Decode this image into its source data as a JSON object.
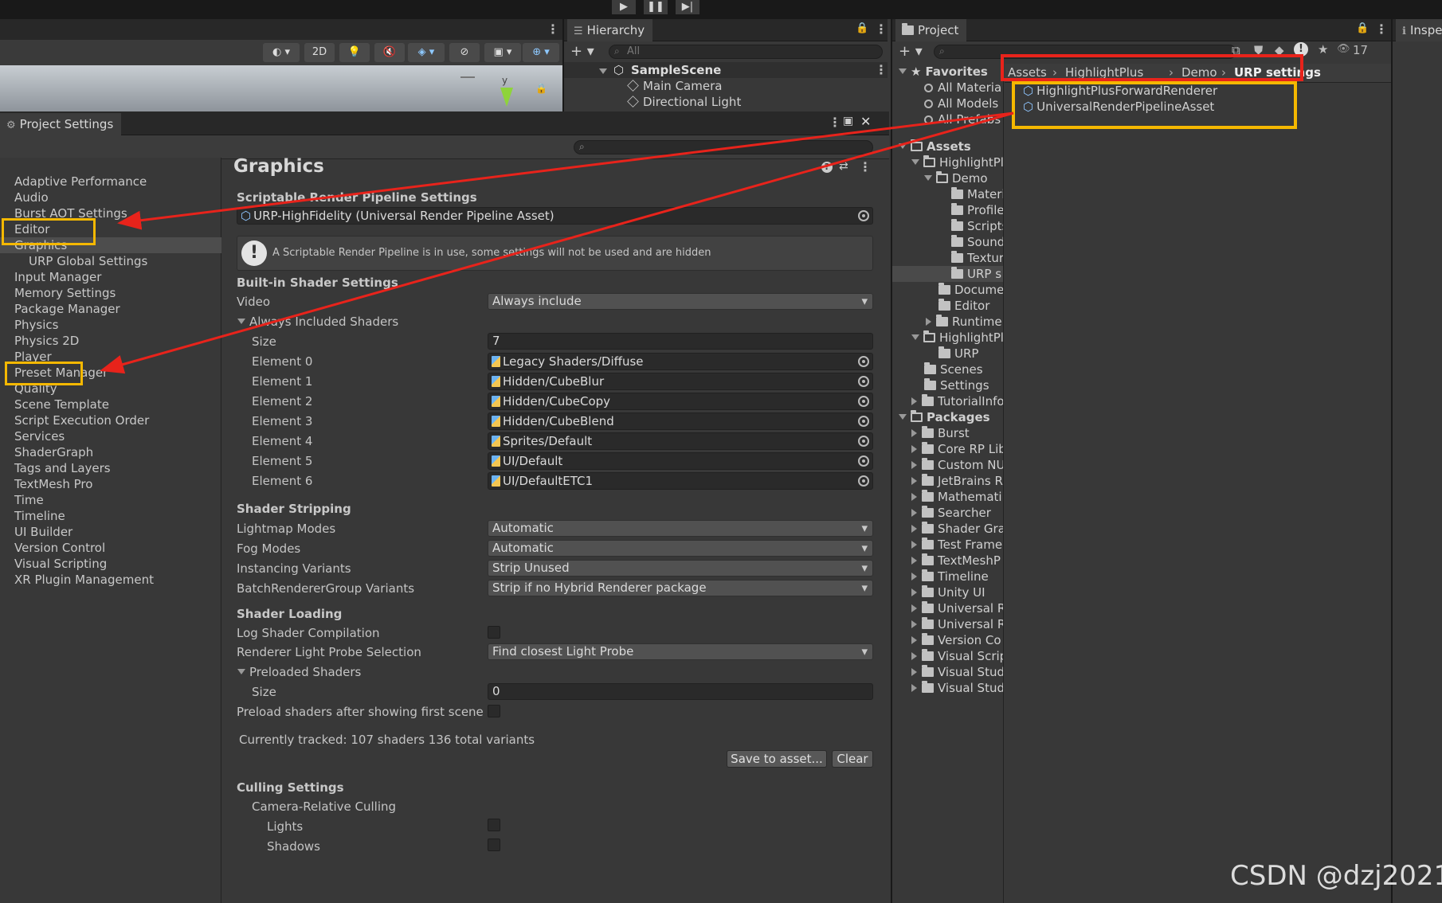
{
  "toolbar": {
    "play": "▶",
    "pause": "❚❚",
    "step": "▶|"
  },
  "scene_toolbar": {
    "mode_2d": "2D",
    "gizmo_axis": "y"
  },
  "hierarchy": {
    "tab": "Hierarchy",
    "search_placeholder": "All",
    "scene": "SampleScene",
    "items": [
      "Main Camera",
      "Directional Light"
    ]
  },
  "project": {
    "tab": "Project",
    "hidden_count": "17",
    "favorites": {
      "label": "Favorites",
      "items": [
        "All Materia",
        "All Models",
        "All Prefabs"
      ]
    },
    "breadcrumb": [
      "Assets",
      "HighlightPlus",
      "Demo",
      "URP settings"
    ],
    "files": [
      "HighlightPlusForwardRenderer",
      "UniversalRenderPipelineAsset"
    ],
    "tree": {
      "assets": "Assets",
      "highlight1": "HighlightPl",
      "demo": "Demo",
      "demo_children": [
        "Materi",
        "Profile",
        "Scripts",
        "Sound",
        "Textur",
        "URP s"
      ],
      "docume": "Docume",
      "editor": "Editor",
      "runtime": "Runtime",
      "highlight2": "HighlightPl",
      "urp": "URP",
      "scenes": "Scenes",
      "settings": "Settings",
      "tutorial": "TutorialInfo",
      "packages": "Packages",
      "packages_children": [
        "Burst",
        "Core RP Lib",
        "Custom NU",
        "JetBrains R",
        "Mathemati",
        "Searcher",
        "Shader Gra",
        "Test Frame",
        "TextMeshP",
        "Timeline",
        "Unity UI",
        "Universal R",
        "Universal R",
        "Version Co",
        "Visual Scrip",
        "Visual Stud",
        "Visual Stud"
      ]
    }
  },
  "inspector": {
    "tab": "Inspe"
  },
  "project_settings": {
    "title": "Project Settings",
    "nav": [
      "Adaptive Performance",
      "Audio",
      "Burst AOT Settings",
      "Editor",
      "Graphics",
      "URP Global Settings",
      "Input Manager",
      "Memory Settings",
      "Package Manager",
      "Physics",
      "Physics 2D",
      "Player",
      "Preset Manager",
      "Quality",
      "Scene Template",
      "Script Execution Order",
      "Services",
      "ShaderGraph",
      "Tags and Layers",
      "TextMesh Pro",
      "Time",
      "Timeline",
      "UI Builder",
      "Version Control",
      "Visual Scripting",
      "XR Plugin Management"
    ],
    "selected": "Graphics"
  },
  "graphics": {
    "title": "Graphics",
    "srp_header": "Scriptable Render Pipeline Settings",
    "srp_asset": "URP-HighFidelity (Universal Render Pipeline Asset)",
    "warning": "A Scriptable Render Pipeline is in use, some settings will not be used and are hidden",
    "builtin_header": "Built-in Shader Settings",
    "video_label": "Video",
    "video_value": "Always include",
    "always_included": "Always Included Shaders",
    "size_label": "Size",
    "size_value": "7",
    "elements": [
      {
        "label": "Element 0",
        "value": "Legacy Shaders/Diffuse"
      },
      {
        "label": "Element 1",
        "value": "Hidden/CubeBlur"
      },
      {
        "label": "Element 2",
        "value": "Hidden/CubeCopy"
      },
      {
        "label": "Element 3",
        "value": "Hidden/CubeBlend"
      },
      {
        "label": "Element 4",
        "value": "Sprites/Default"
      },
      {
        "label": "Element 5",
        "value": "UI/Default"
      },
      {
        "label": "Element 6",
        "value": "UI/DefaultETC1"
      }
    ],
    "stripping_header": "Shader Stripping",
    "stripping": [
      {
        "label": "Lightmap Modes",
        "value": "Automatic"
      },
      {
        "label": "Fog Modes",
        "value": "Automatic"
      },
      {
        "label": "Instancing Variants",
        "value": "Strip Unused"
      },
      {
        "label": "BatchRendererGroup Variants",
        "value": "Strip if no Hybrid Renderer package"
      }
    ],
    "loading_header": "Shader Loading",
    "log_compilation": "Log Shader Compilation",
    "probe_label": "Renderer Light Probe Selection",
    "probe_value": "Find closest Light Probe",
    "preloaded": "Preloaded Shaders",
    "preloaded_size_label": "Size",
    "preloaded_size": "0",
    "preload_after": "Preload shaders after showing first scene",
    "tracked": "Currently tracked: 107 shaders 136 total variants",
    "save_button": "Save to asset...",
    "clear_button": "Clear",
    "culling_header": "Culling Settings",
    "camera_relative": "Camera-Relative Culling",
    "lights": "Lights",
    "shadows": "Shadows"
  },
  "watermark": "CSDN @dzj2021",
  "colors": {
    "highlight_yellow": "#f5b800",
    "highlight_red": "#e8231b",
    "arrow_red": "#e8231b"
  }
}
